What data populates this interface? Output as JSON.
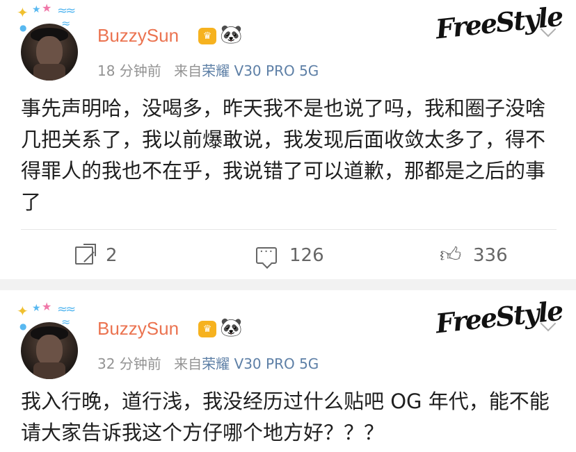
{
  "posts": [
    {
      "username": "BuzzySun",
      "time": "18 分钟前",
      "source_prefix": "来自",
      "device": "荣耀 V30 PRO 5G",
      "badge_text": "FreeStyle",
      "content": "事先声明哈，没喝多，昨天我不是也说了吗，我和圈子没啥几把关系了，我以前爆敢说，我发现后面收敛太多了，得不得罪人的我也不在乎，我说错了可以道歉，那都是之后的事了",
      "reposts": "2",
      "comments": "126",
      "likes": "336"
    },
    {
      "username": "BuzzySun",
      "time": "32 分钟前",
      "source_prefix": "来自",
      "device": "荣耀 V30 PRO 5G",
      "badge_text": "FreeStyle",
      "content": "我入行晚，道行浅，我没经历过什么贴吧 OG 年代，能不能请大家告诉我这个方仔哪个地方好？？？"
    }
  ],
  "icons": {
    "share": "share-icon",
    "comment": "comment-icon",
    "like": "thumbs-up-icon",
    "chevron": "chevron-down-icon",
    "crown": "crown-badge-icon",
    "panda": "panda-icon"
  },
  "colors": {
    "username": "#eb7350",
    "device": "#5d7fa6",
    "meta": "#939393",
    "separator": "#f2f2f2"
  }
}
